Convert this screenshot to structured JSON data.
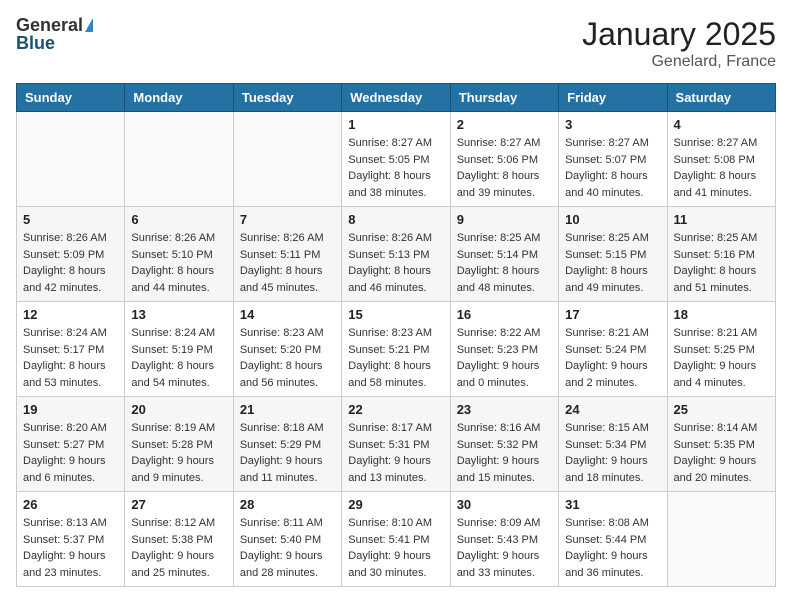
{
  "logo": {
    "general": "General",
    "blue": "Blue"
  },
  "title": "January 2025",
  "location": "Genelard, France",
  "days": [
    "Sunday",
    "Monday",
    "Tuesday",
    "Wednesday",
    "Thursday",
    "Friday",
    "Saturday"
  ],
  "weeks": [
    [
      {
        "day": "",
        "lines": []
      },
      {
        "day": "",
        "lines": []
      },
      {
        "day": "",
        "lines": []
      },
      {
        "day": "1",
        "lines": [
          "Sunrise: 8:27 AM",
          "Sunset: 5:05 PM",
          "Daylight: 8 hours",
          "and 38 minutes."
        ]
      },
      {
        "day": "2",
        "lines": [
          "Sunrise: 8:27 AM",
          "Sunset: 5:06 PM",
          "Daylight: 8 hours",
          "and 39 minutes."
        ]
      },
      {
        "day": "3",
        "lines": [
          "Sunrise: 8:27 AM",
          "Sunset: 5:07 PM",
          "Daylight: 8 hours",
          "and 40 minutes."
        ]
      },
      {
        "day": "4",
        "lines": [
          "Sunrise: 8:27 AM",
          "Sunset: 5:08 PM",
          "Daylight: 8 hours",
          "and 41 minutes."
        ]
      }
    ],
    [
      {
        "day": "5",
        "lines": [
          "Sunrise: 8:26 AM",
          "Sunset: 5:09 PM",
          "Daylight: 8 hours",
          "and 42 minutes."
        ]
      },
      {
        "day": "6",
        "lines": [
          "Sunrise: 8:26 AM",
          "Sunset: 5:10 PM",
          "Daylight: 8 hours",
          "and 44 minutes."
        ]
      },
      {
        "day": "7",
        "lines": [
          "Sunrise: 8:26 AM",
          "Sunset: 5:11 PM",
          "Daylight: 8 hours",
          "and 45 minutes."
        ]
      },
      {
        "day": "8",
        "lines": [
          "Sunrise: 8:26 AM",
          "Sunset: 5:13 PM",
          "Daylight: 8 hours",
          "and 46 minutes."
        ]
      },
      {
        "day": "9",
        "lines": [
          "Sunrise: 8:25 AM",
          "Sunset: 5:14 PM",
          "Daylight: 8 hours",
          "and 48 minutes."
        ]
      },
      {
        "day": "10",
        "lines": [
          "Sunrise: 8:25 AM",
          "Sunset: 5:15 PM",
          "Daylight: 8 hours",
          "and 49 minutes."
        ]
      },
      {
        "day": "11",
        "lines": [
          "Sunrise: 8:25 AM",
          "Sunset: 5:16 PM",
          "Daylight: 8 hours",
          "and 51 minutes."
        ]
      }
    ],
    [
      {
        "day": "12",
        "lines": [
          "Sunrise: 8:24 AM",
          "Sunset: 5:17 PM",
          "Daylight: 8 hours",
          "and 53 minutes."
        ]
      },
      {
        "day": "13",
        "lines": [
          "Sunrise: 8:24 AM",
          "Sunset: 5:19 PM",
          "Daylight: 8 hours",
          "and 54 minutes."
        ]
      },
      {
        "day": "14",
        "lines": [
          "Sunrise: 8:23 AM",
          "Sunset: 5:20 PM",
          "Daylight: 8 hours",
          "and 56 minutes."
        ]
      },
      {
        "day": "15",
        "lines": [
          "Sunrise: 8:23 AM",
          "Sunset: 5:21 PM",
          "Daylight: 8 hours",
          "and 58 minutes."
        ]
      },
      {
        "day": "16",
        "lines": [
          "Sunrise: 8:22 AM",
          "Sunset: 5:23 PM",
          "Daylight: 9 hours",
          "and 0 minutes."
        ]
      },
      {
        "day": "17",
        "lines": [
          "Sunrise: 8:21 AM",
          "Sunset: 5:24 PM",
          "Daylight: 9 hours",
          "and 2 minutes."
        ]
      },
      {
        "day": "18",
        "lines": [
          "Sunrise: 8:21 AM",
          "Sunset: 5:25 PM",
          "Daylight: 9 hours",
          "and 4 minutes."
        ]
      }
    ],
    [
      {
        "day": "19",
        "lines": [
          "Sunrise: 8:20 AM",
          "Sunset: 5:27 PM",
          "Daylight: 9 hours",
          "and 6 minutes."
        ]
      },
      {
        "day": "20",
        "lines": [
          "Sunrise: 8:19 AM",
          "Sunset: 5:28 PM",
          "Daylight: 9 hours",
          "and 9 minutes."
        ]
      },
      {
        "day": "21",
        "lines": [
          "Sunrise: 8:18 AM",
          "Sunset: 5:29 PM",
          "Daylight: 9 hours",
          "and 11 minutes."
        ]
      },
      {
        "day": "22",
        "lines": [
          "Sunrise: 8:17 AM",
          "Sunset: 5:31 PM",
          "Daylight: 9 hours",
          "and 13 minutes."
        ]
      },
      {
        "day": "23",
        "lines": [
          "Sunrise: 8:16 AM",
          "Sunset: 5:32 PM",
          "Daylight: 9 hours",
          "and 15 minutes."
        ]
      },
      {
        "day": "24",
        "lines": [
          "Sunrise: 8:15 AM",
          "Sunset: 5:34 PM",
          "Daylight: 9 hours",
          "and 18 minutes."
        ]
      },
      {
        "day": "25",
        "lines": [
          "Sunrise: 8:14 AM",
          "Sunset: 5:35 PM",
          "Daylight: 9 hours",
          "and 20 minutes."
        ]
      }
    ],
    [
      {
        "day": "26",
        "lines": [
          "Sunrise: 8:13 AM",
          "Sunset: 5:37 PM",
          "Daylight: 9 hours",
          "and 23 minutes."
        ]
      },
      {
        "day": "27",
        "lines": [
          "Sunrise: 8:12 AM",
          "Sunset: 5:38 PM",
          "Daylight: 9 hours",
          "and 25 minutes."
        ]
      },
      {
        "day": "28",
        "lines": [
          "Sunrise: 8:11 AM",
          "Sunset: 5:40 PM",
          "Daylight: 9 hours",
          "and 28 minutes."
        ]
      },
      {
        "day": "29",
        "lines": [
          "Sunrise: 8:10 AM",
          "Sunset: 5:41 PM",
          "Daylight: 9 hours",
          "and 30 minutes."
        ]
      },
      {
        "day": "30",
        "lines": [
          "Sunrise: 8:09 AM",
          "Sunset: 5:43 PM",
          "Daylight: 9 hours",
          "and 33 minutes."
        ]
      },
      {
        "day": "31",
        "lines": [
          "Sunrise: 8:08 AM",
          "Sunset: 5:44 PM",
          "Daylight: 9 hours",
          "and 36 minutes."
        ]
      },
      {
        "day": "",
        "lines": []
      }
    ]
  ]
}
